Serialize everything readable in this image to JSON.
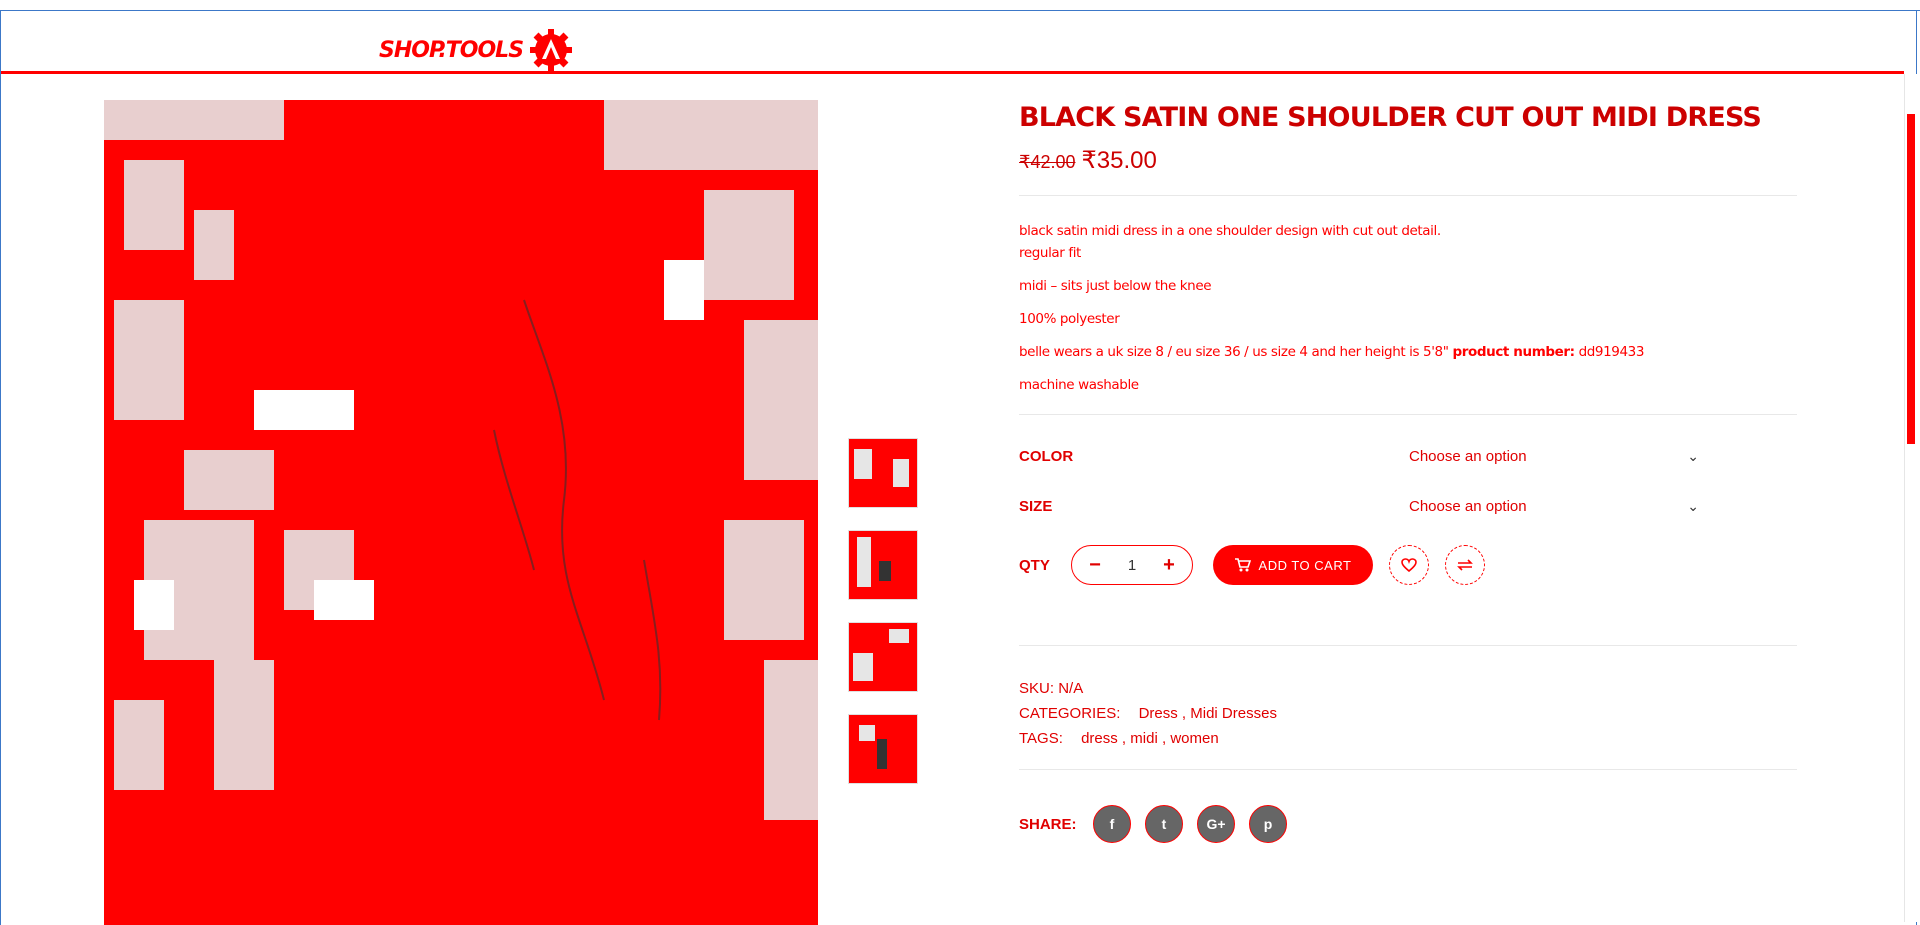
{
  "brand": {
    "logo_text": "SHOP.TOOLS"
  },
  "product": {
    "title": "BLACK SATIN ONE SHOULDER CUT OUT MIDI DRESS",
    "price_old": "₹42.00",
    "price_new": "₹35.00",
    "description": {
      "line1": "black satin midi dress in a one shoulder design with cut out detail.",
      "line2": "regular fit",
      "line3": "midi – sits just below the knee",
      "line4": "100% polyester",
      "line5_text": "belle wears a uk size 8 / eu size 36 / us size 4 and her height is 5'8\"",
      "line5_bold": "product number:",
      "line5_number": "dd919433",
      "line6": "machine washable"
    },
    "variations": {
      "color": {
        "label": "COLOR",
        "value": "Choose an option"
      },
      "size": {
        "label": "SIZE",
        "value": "Choose an option"
      }
    },
    "qty": {
      "label": "QTY",
      "minus": "−",
      "value": "1",
      "plus": "+"
    },
    "add_to_cart": "ADD TO CART",
    "meta": {
      "sku_label": "SKU:",
      "sku_value": "N/A",
      "categories_label": "CATEGORIES:",
      "categories": [
        "Dress",
        "Midi Dresses"
      ],
      "tags_label": "TAGS:",
      "tags": [
        "dress",
        "midi",
        "women"
      ]
    },
    "share": {
      "label": "SHARE:",
      "networks": [
        "f",
        "t",
        "G+",
        "p"
      ]
    }
  },
  "icons": [
    "cart-icon",
    "heart-icon",
    "compare-icon",
    "facebook-icon",
    "twitter-icon",
    "google-plus-icon",
    "pinterest-icon",
    "chevron-down-icon"
  ],
  "colors": {
    "accent": "#ff0000",
    "social_bg": "#666666"
  }
}
